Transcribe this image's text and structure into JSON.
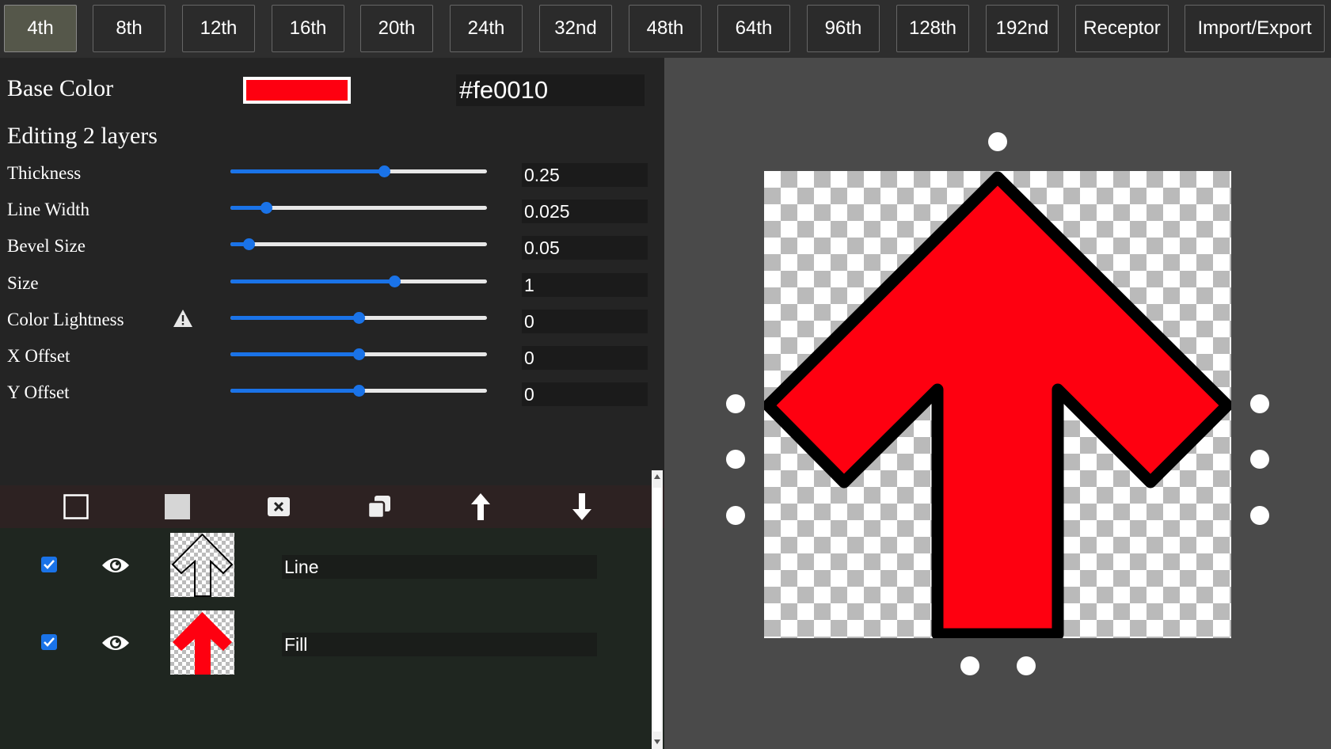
{
  "tabs": [
    {
      "label": "4th",
      "active": true
    },
    {
      "label": "8th"
    },
    {
      "label": "12th"
    },
    {
      "label": "16th"
    },
    {
      "label": "20th"
    },
    {
      "label": "24th"
    },
    {
      "label": "32nd"
    },
    {
      "label": "48th"
    },
    {
      "label": "64th"
    },
    {
      "label": "96th"
    },
    {
      "label": "128th"
    },
    {
      "label": "192nd"
    },
    {
      "label": "Receptor"
    },
    {
      "label": "Import/Export"
    }
  ],
  "editor": {
    "base_color_label": "Base Color",
    "base_color_value": "#fe0010",
    "editing_label": "Editing 2 layers",
    "properties": [
      {
        "label": "Thickness",
        "value": "0.25",
        "slider_fraction": 0.6
      },
      {
        "label": "Line Width",
        "value": "0.025",
        "slider_fraction": 0.14
      },
      {
        "label": "Bevel Size",
        "value": "0.05",
        "slider_fraction": 0.07
      },
      {
        "label": "Size",
        "value": "1",
        "slider_fraction": 0.64
      },
      {
        "label": "Color Lightness",
        "value": "0",
        "slider_fraction": 0.5,
        "warning_icon": "warning-icon"
      },
      {
        "label": "X Offset",
        "value": "0",
        "slider_fraction": 0.5
      },
      {
        "label": "Y Offset",
        "value": "0",
        "slider_fraction": 0.5
      }
    ]
  },
  "layer_toolbar": {
    "icons": [
      "new-outline-layer-icon",
      "new-fill-layer-icon",
      "delete-layer-icon",
      "duplicate-layer-icon",
      "move-up-icon",
      "move-down-icon"
    ]
  },
  "layers": [
    {
      "name": "Line",
      "checked": true,
      "visible": true,
      "thumb": "arrow-outline"
    },
    {
      "name": "Fill",
      "checked": true,
      "visible": true,
      "thumb": "arrow-fill"
    }
  ],
  "colors": {
    "accent": "#1a73e8",
    "arrow_fill": "#fe0010",
    "active_tab": "#55574a"
  }
}
